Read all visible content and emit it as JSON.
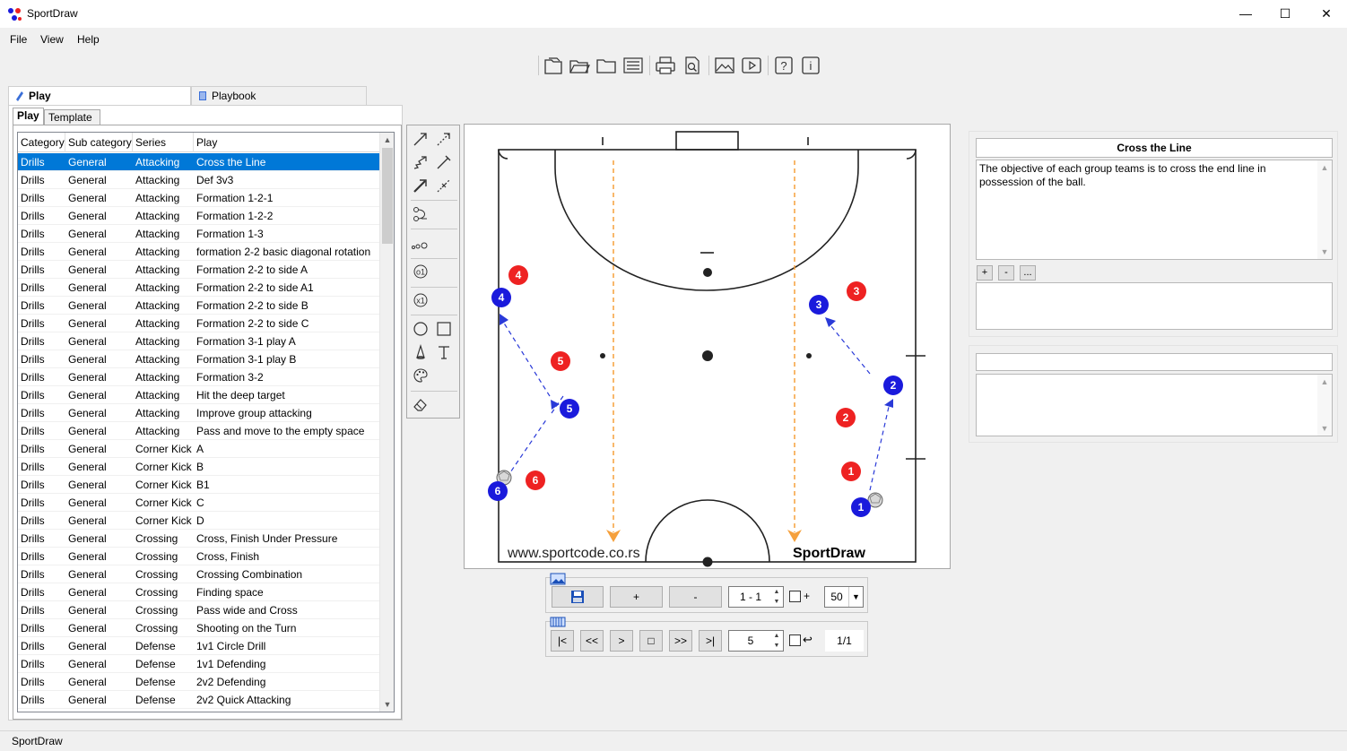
{
  "window": {
    "title": "SportDraw",
    "minimize": "—",
    "maximize": "☐",
    "close": "✕"
  },
  "menu": [
    "File",
    "View",
    "Help"
  ],
  "toolbar": [
    "new-play-icon",
    "open-folder-icon",
    "folder-icon",
    "list-icon",
    "print-icon",
    "print-preview-icon",
    "image-icon",
    "video-icon",
    "help-icon",
    "info-icon"
  ],
  "tabs": {
    "outer": [
      "Play",
      "Playbook"
    ],
    "inner": [
      "Play",
      "Template"
    ]
  },
  "grid": {
    "columns": [
      "Category",
      "Sub category",
      "Series",
      "Play"
    ],
    "selected_index": 0,
    "rows": [
      [
        "Drills",
        "General",
        "Attacking",
        "Cross the Line"
      ],
      [
        "Drills",
        "General",
        "Attacking",
        "Def 3v3"
      ],
      [
        "Drills",
        "General",
        "Attacking",
        "Formation 1-2-1"
      ],
      [
        "Drills",
        "General",
        "Attacking",
        "Formation 1-2-2"
      ],
      [
        "Drills",
        "General",
        "Attacking",
        "Formation 1-3"
      ],
      [
        "Drills",
        "General",
        "Attacking",
        "formation 2-2 basic diagonal rotation"
      ],
      [
        "Drills",
        "General",
        "Attacking",
        "Formation 2-2 to side A"
      ],
      [
        "Drills",
        "General",
        "Attacking",
        "Formation 2-2 to side A1"
      ],
      [
        "Drills",
        "General",
        "Attacking",
        "Formation 2-2 to side B"
      ],
      [
        "Drills",
        "General",
        "Attacking",
        "Formation 2-2 to side C"
      ],
      [
        "Drills",
        "General",
        "Attacking",
        "Formation 3-1 play A"
      ],
      [
        "Drills",
        "General",
        "Attacking",
        "Formation 3-1 play B"
      ],
      [
        "Drills",
        "General",
        "Attacking",
        "Formation 3-2"
      ],
      [
        "Drills",
        "General",
        "Attacking",
        "Hit the deep target"
      ],
      [
        "Drills",
        "General",
        "Attacking",
        "Improve group attacking"
      ],
      [
        "Drills",
        "General",
        "Attacking",
        "Pass and move to the empty space"
      ],
      [
        "Drills",
        "General",
        "Corner Kick",
        "A"
      ],
      [
        "Drills",
        "General",
        "Corner Kick",
        "B"
      ],
      [
        "Drills",
        "General",
        "Corner Kick",
        "B1"
      ],
      [
        "Drills",
        "General",
        "Corner Kick",
        "C"
      ],
      [
        "Drills",
        "General",
        "Corner Kick",
        "D"
      ],
      [
        "Drills",
        "General",
        "Crossing",
        "Cross, Finish Under Pressure"
      ],
      [
        "Drills",
        "General",
        "Crossing",
        "Cross, Finish"
      ],
      [
        "Drills",
        "General",
        "Crossing",
        "Crossing Combination"
      ],
      [
        "Drills",
        "General",
        "Crossing",
        "Finding space"
      ],
      [
        "Drills",
        "General",
        "Crossing",
        "Pass wide and Cross"
      ],
      [
        "Drills",
        "General",
        "Crossing",
        "Shooting on the Turn"
      ],
      [
        "Drills",
        "General",
        "Defense",
        "1v1 Circle Drill"
      ],
      [
        "Drills",
        "General",
        "Defense",
        "1v1 Defending"
      ],
      [
        "Drills",
        "General",
        "Defense",
        "2v2 Defending"
      ],
      [
        "Drills",
        "General",
        "Defense",
        "2v2 Quick Attacking"
      ]
    ]
  },
  "court": {
    "watermark_left": "www.sportcode.co.rs",
    "watermark_right": "SportDraw",
    "blue_players": [
      {
        "label": "4"
      },
      {
        "label": "5"
      },
      {
        "label": "6"
      },
      {
        "label": "3"
      },
      {
        "label": "2"
      },
      {
        "label": "1"
      }
    ],
    "red_players": [
      {
        "label": "4"
      },
      {
        "label": "5"
      },
      {
        "label": "6"
      },
      {
        "label": "3"
      },
      {
        "label": "2"
      },
      {
        "label": "1"
      }
    ],
    "colors": {
      "blue": "#1a1adc",
      "red": "#ee2222",
      "orange": "#f5a03c",
      "arrow": "#2a3ad8"
    }
  },
  "controls": {
    "frame_add": "+",
    "frame_remove": "-",
    "frame_range": "1 - 1",
    "frame_check_label": "+",
    "zoom_value": "50",
    "nav_first": "|<",
    "nav_prev_fast": "<<",
    "nav_play": ">",
    "nav_stop": "□",
    "nav_next_fast": ">>",
    "nav_last": ">|",
    "speed_value": "5",
    "loop_label": "↩",
    "page_counter": "1/1"
  },
  "info": {
    "play_title": "Cross the Line",
    "play_description": "The objective of each group teams is to cross the end line in possession of the ball.",
    "add_label": "+",
    "remove_label": "-",
    "more_label": "..."
  },
  "status": "SportDraw"
}
